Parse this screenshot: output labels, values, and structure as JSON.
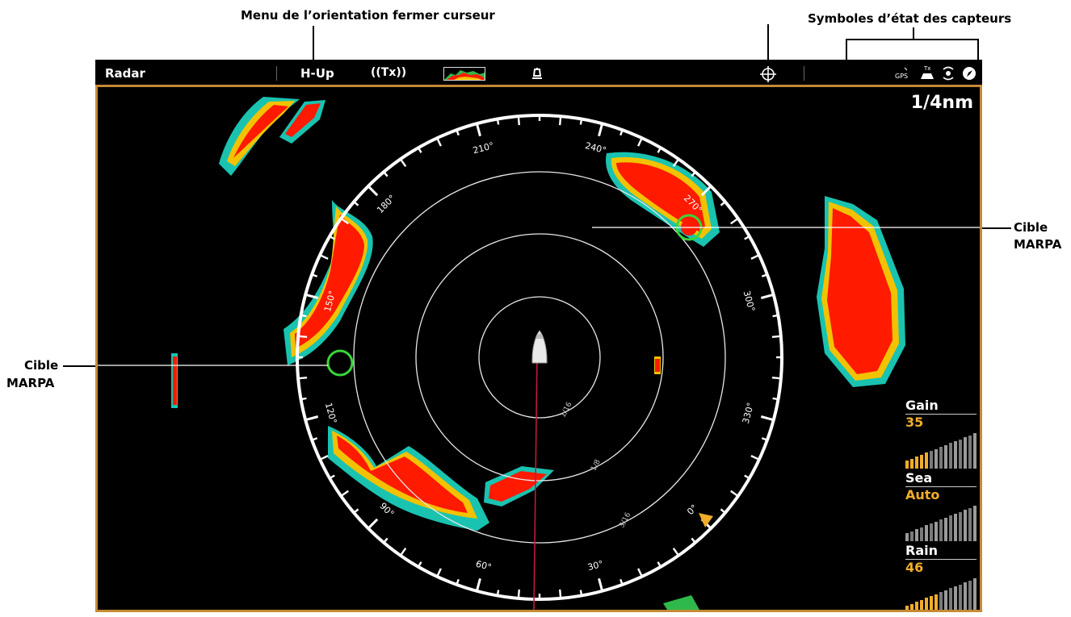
{
  "annotations": {
    "orientation_menu": "Menu de l’orientation fermer curseur",
    "sensor_status": "Symboles d’état des capteurs",
    "marpa_target_right_line1": "Cible",
    "marpa_target_right_line2": "MARPA",
    "marpa_target_left_line1": "Cible",
    "marpa_target_left_line2": "MARPA"
  },
  "topbar": {
    "title": "Radar",
    "orientation": "H-Up",
    "transmit": "((Tx))",
    "sensors": [
      "gps-icon",
      "tx-icon",
      "sonar-icon",
      "compass-icon"
    ],
    "gps_label": "GPS",
    "tx_label": "Tx"
  },
  "display": {
    "range": "1/4nm",
    "bearings": [
      {
        "label": "210°",
        "deg": 210
      },
      {
        "label": "240°",
        "deg": 240
      },
      {
        "label": "270°",
        "deg": 270
      },
      {
        "label": "180°",
        "deg": 180
      },
      {
        "label": "300°",
        "deg": 300
      },
      {
        "label": "150°",
        "deg": 150
      },
      {
        "label": "330°",
        "deg": 330
      },
      {
        "label": "120°",
        "deg": 120
      },
      {
        "label": "0°",
        "deg": 0
      },
      {
        "label": "90°",
        "deg": 90
      },
      {
        "label": "60°",
        "deg": 60
      },
      {
        "label": "30°",
        "deg": 30
      }
    ],
    "range_rings": [
      "1/16",
      "1/8",
      "3/16"
    ]
  },
  "controls": [
    {
      "label": "Gain",
      "value": "35",
      "level": 0.35
    },
    {
      "label": "Sea",
      "value": "Auto",
      "level": 0
    },
    {
      "label": "Rain",
      "value": "46",
      "level": 0.46
    }
  ],
  "colors": {
    "echo_core": "#ff1a00",
    "echo_mid": "#f2c200",
    "echo_edge": "#19c3b0",
    "marpa": "#39d639",
    "frame": "#c58a35",
    "accent": "#f2ad2b"
  }
}
